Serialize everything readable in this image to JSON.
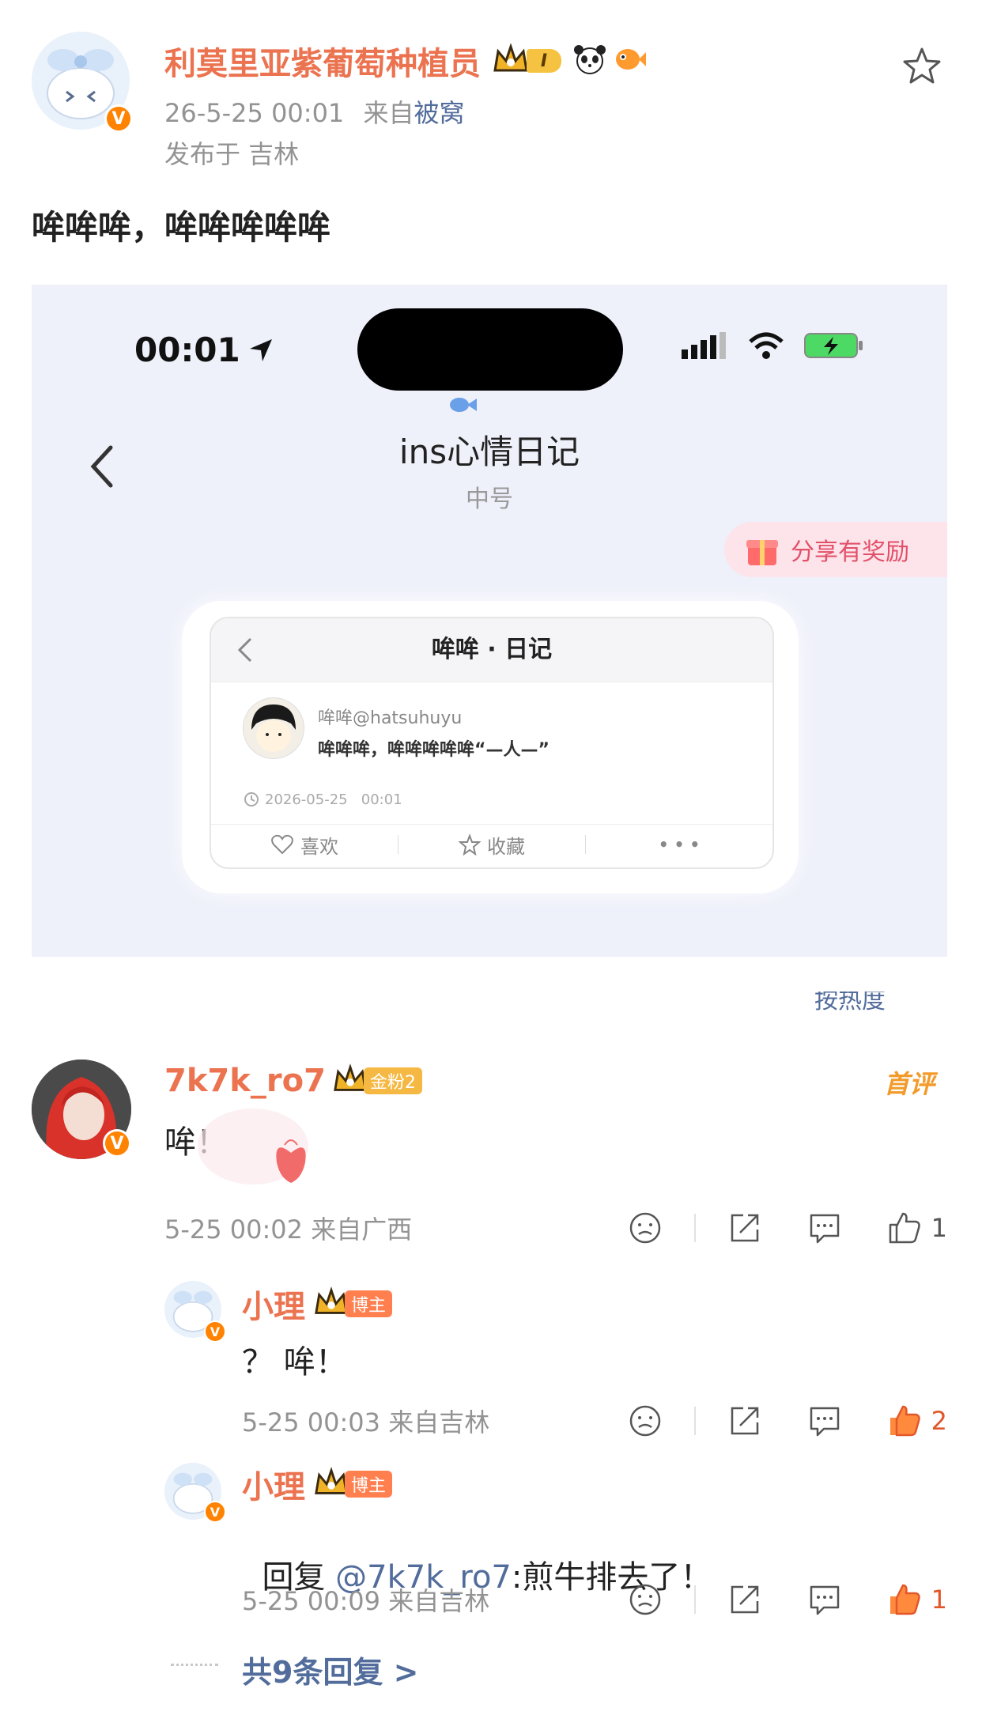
{
  "post": {
    "author_name": "利莫里亚紫葡萄种植员",
    "timestamp": "26-5-25 00:01",
    "source_prefix": "来自",
    "source_app": "被窝",
    "location": "发布于 吉林",
    "text": "哞哞哞，哞哞哞哞哞",
    "level_badge": "I",
    "icons": [
      "star-outline-icon",
      "crown-icon",
      "panda-icon",
      "fish-icon",
      "verified-icon"
    ]
  },
  "screenshot": {
    "status_time": "00:01",
    "page_title": "ins心情日记",
    "page_subtitle": "中号",
    "share_reward": "分享有奖励",
    "card": {
      "title": "哞哞 · 日记",
      "handle": "哞哞@hatsuhuyu",
      "content": "哞哞哞，哞哞哞哞哞“—人—”",
      "datetime": "2026-05-25   00:01",
      "like_label": "喜欢",
      "collect_label": "收藏",
      "more_label": "• • •"
    }
  },
  "sort_label": "按热度",
  "comments": [
    {
      "name": "7k7k_ro7",
      "badge": "金粉2",
      "first_label": "首评",
      "text": "哞！",
      "meta": "5-25 00:02 来自广西",
      "likes": "1",
      "liked": false
    }
  ],
  "replies": [
    {
      "name": "小理",
      "badge": "博主",
      "text": "？ 哞！",
      "meta": "5-25 00:03 来自吉林",
      "likes": "2",
      "liked": true
    },
    {
      "name": "小理",
      "badge": "博主",
      "text_prefix": "回复 ",
      "mention": "@7k7k_ro7",
      "text_rest": ":煎牛排去了！",
      "meta": "5-25 00:09 来自吉林",
      "likes": "1",
      "liked": true
    }
  ],
  "more_replies": "共9条回复 >",
  "colors": {
    "accent": "#eb7350",
    "orange_badge": "#ff8200",
    "gold_badge": "#f5b843",
    "link": "#526c9b",
    "gray": "#939393",
    "screenshot_bg": "#eef0fa"
  }
}
